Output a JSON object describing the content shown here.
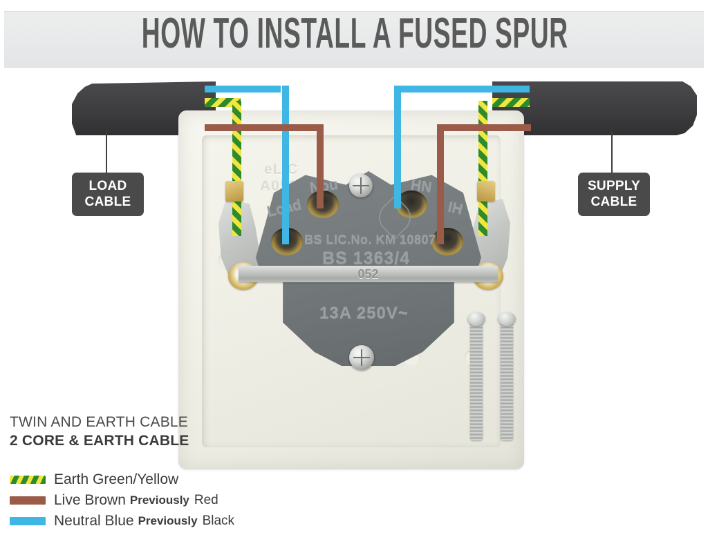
{
  "header": {
    "title": "HOW TO INSTALL A FUSED SPUR"
  },
  "callouts": {
    "load": {
      "line1": "LOAD",
      "line2": "CABLE"
    },
    "supply": {
      "line1": "SUPPLY",
      "line2": "CABLE"
    }
  },
  "socket": {
    "plate_emboss_1": "eLIC",
    "plate_emboss_2": "A050",
    "terminal_labels": {
      "load": "Load",
      "neutral": "Nou",
      "in_right_top": "HN",
      "in_right_bottom": "IH"
    },
    "markings": {
      "bs_licence": "BS LIC.No. KM 10807",
      "standard": "BS 1363/4",
      "strap_code": "052",
      "rating": "13A 250V~"
    }
  },
  "legend": {
    "cable_type_line1": "TWIN AND EARTH CABLE",
    "cable_type_line2": "2 CORE & EARTH CABLE",
    "rows": [
      {
        "label": "Earth Green/Yellow",
        "note": "",
        "old": "",
        "color": "#2d8a2d"
      },
      {
        "label": "Live Brown",
        "note": "Previously",
        "old": "Red",
        "color": "#9a5b48"
      },
      {
        "label": "Neutral Blue",
        "note": "Previously",
        "old": "Black",
        "color": "#3fb7e4"
      }
    ]
  },
  "colors": {
    "earth_green": "#2d8a2d",
    "earth_yellow": "#f2e63e",
    "live_brown": "#9a5b48",
    "neutral_blue": "#3fb7e4",
    "cable_sheath": "#403f41",
    "callout_bg": "#4a4a4a",
    "title_text": "#5a5a5a",
    "header_band": "#e8e9ea"
  }
}
